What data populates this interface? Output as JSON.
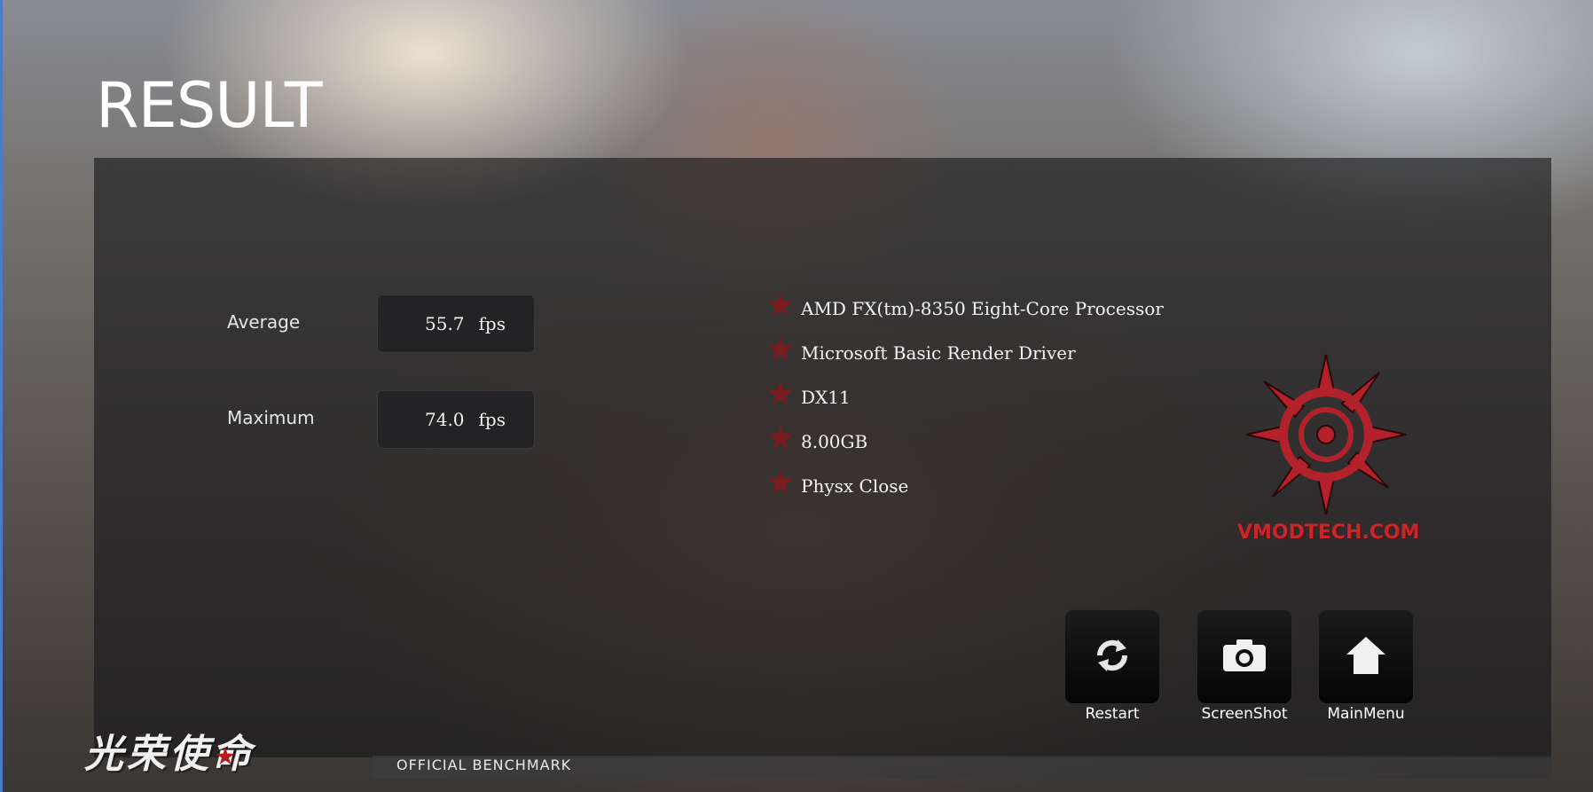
{
  "title": "RESULT",
  "stats": {
    "average": {
      "label": "Average",
      "value": "55.7",
      "unit": "fps"
    },
    "maximum": {
      "label": "Maximum",
      "value": "74.0",
      "unit": "fps"
    }
  },
  "specs": [
    "AMD FX(tm)-8350 Eight-Core Processor",
    "Microsoft Basic Render Driver",
    "DX11",
    "8.00GB",
    "Physx Close"
  ],
  "watermark": {
    "text": "VMODTECH.COM",
    "color": "#c7262a"
  },
  "buttons": {
    "restart": {
      "label": "Restart",
      "icon": "refresh-icon"
    },
    "screenshot": {
      "label": "ScreenShot",
      "icon": "camera-icon"
    },
    "mainmenu": {
      "label": "MainMenu",
      "icon": "home-icon"
    }
  },
  "brand": {
    "logo_text": "光荣使命",
    "subtitle": "OFFICIAL BENCHMARK"
  },
  "colors": {
    "accent_red": "#7a1a1c",
    "panel": "#161618",
    "left_edge": "#4a7cc9"
  }
}
